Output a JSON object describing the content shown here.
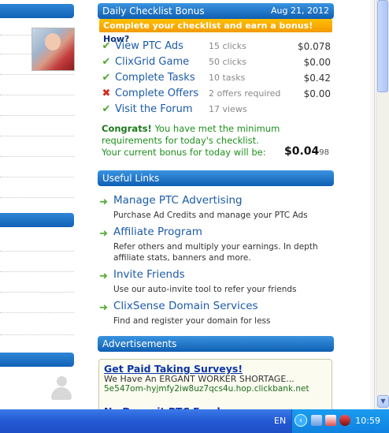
{
  "checklist": {
    "title": "Daily Checklist Bonus",
    "date": "Aug 21, 2012",
    "promo": "Complete your checklist and earn a bonus!",
    "promo_link": "How?",
    "items": [
      {
        "status": "done",
        "label": "View PTC Ads",
        "meta": "15 clicks",
        "amount": "$0.078"
      },
      {
        "status": "done",
        "label": "ClixGrid Game",
        "meta": "50 clicks",
        "amount": "$0.00"
      },
      {
        "status": "done",
        "label": "Complete Tasks",
        "meta": "10 tasks",
        "amount": "$0.42"
      },
      {
        "status": "failed",
        "label": "Complete Offers",
        "meta": "2 offers required",
        "amount": "$0.00"
      },
      {
        "status": "done",
        "label": "Visit the Forum",
        "meta": "17 views",
        "amount": ""
      }
    ],
    "congrats_head": "Congrats!",
    "congrats_text": "You have met the minimum requirements for today's checklist.",
    "bonus_label": "Your current bonus for today will be:",
    "bonus_main": "$0.04",
    "bonus_fraction": "98"
  },
  "useful_links": {
    "title": "Useful Links",
    "items": [
      {
        "title": "Manage PTC Advertising",
        "desc": "Purchase Ad Credits and manage your PTC Ads"
      },
      {
        "title": "Affiliate Program",
        "desc": "Refer others and multiply your earnings. In depth affiliate stats, banners and more."
      },
      {
        "title": "Invite Friends",
        "desc": "Use our auto-invite tool to refer your friends"
      },
      {
        "title": "ClixSense Domain Services",
        "desc": "Find and register your domain for less"
      }
    ]
  },
  "advertisements": {
    "title": "Advertisements",
    "ad1_title": "Get Paid Taking Surveys!",
    "ad1_line": "We Have An ERGANT WORKER SHORTAGE...",
    "ad1_url": "5e547om-hyjmfy2iw8uz7qcs4u.hop.clickbank.net",
    "ad2_title": "No Deposit PTC Funds"
  },
  "taskbar": {
    "language": "EN",
    "clock": "10:59"
  },
  "colors": {
    "header_blue": "#1162b6",
    "promo_orange": "#f39a00",
    "link_blue": "#1c5ba7",
    "check_green": "#52a82c",
    "fail_red": "#d02a1d"
  }
}
